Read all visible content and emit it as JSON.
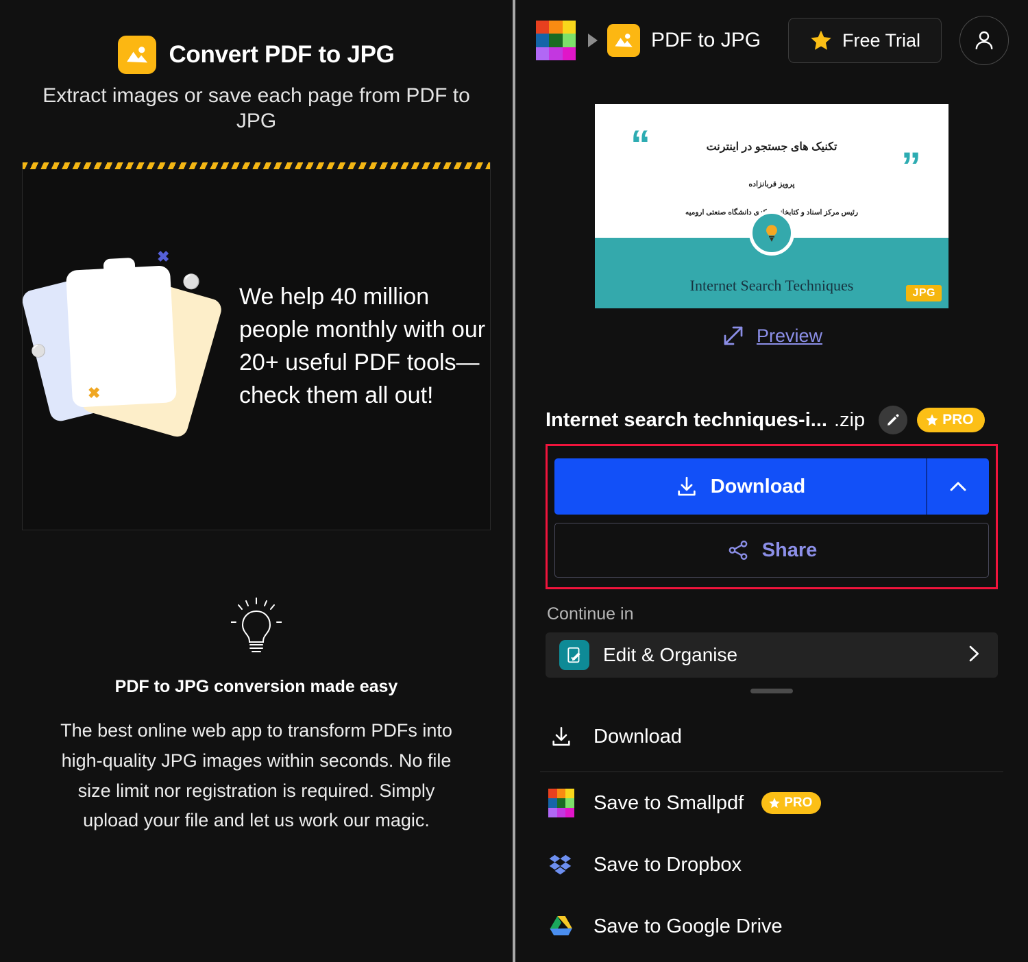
{
  "left_panel": {
    "tool_icon": "image-icon",
    "title": "Convert PDF to JPG",
    "subtitle": "Extract images or save each page from PDF to JPG",
    "promo": {
      "text": "We help 40 million people monthly with our 20+ useful PDF tools—check them all out!",
      "art": "stacked-paper-cards-illustration",
      "marks": [
        "x",
        "o",
        "o",
        "x"
      ]
    },
    "tip": {
      "icon": "lightbulb-icon",
      "title": "PDF to JPG conversion made easy",
      "body": "The best online web app to transform PDFs into high-quality JPG images within seconds. No file size limit nor registration is required. Simply upload your file and let us work our magic."
    }
  },
  "right_panel": {
    "topbar": {
      "logo": "smallpdf-logo",
      "breadcrumb_separator": "caret-right-icon",
      "tool_icon": "image-icon",
      "tool_name": "PDF to JPG",
      "free_trial_label": "Free Trial",
      "free_trial_icon": "star-icon",
      "account_icon": "user-avatar-icon"
    },
    "preview": {
      "slide_title_fa": "تکنیک های جستجو در اینترنت",
      "slide_author_fa": "پرویز قربانزاده",
      "slide_affiliation_fa": "رئیس مرکز اسناد و کتابخانه مرکزی دانشگاه صنعتی ارومیه",
      "slide_title_en": "Internet Search Techniques",
      "format_badge": "JPG",
      "quote_open": "“",
      "quote_close": "”",
      "bulb_icon": "lightbulb-icon",
      "preview_link": "Preview",
      "preview_icon": "expand-arrow-icon"
    },
    "file": {
      "name": "Internet search techniques-i...",
      "extension": ".zip",
      "edit_icon": "pencil-icon",
      "pro_badge": "PRO",
      "pro_icon": "star-icon"
    },
    "actions": {
      "download_label": "Download",
      "download_icon": "download-icon",
      "download_caret": "chevron-up-icon",
      "share_label": "Share",
      "share_icon": "share-nodes-icon",
      "highlight_color": "#f0143c",
      "download_color": "#1250f8"
    },
    "continue": {
      "section_label": "Continue in",
      "item_label": "Edit & Organise",
      "item_icon": "edit-document-icon",
      "chevron": "chevron-right-icon"
    },
    "menu": [
      {
        "label": "Download",
        "icon": "download-icon",
        "badge": null
      },
      {
        "label": "Save to Smallpdf",
        "icon": "smallpdf-logo-icon",
        "badge": "PRO"
      },
      {
        "label": "Save to Dropbox",
        "icon": "dropbox-icon",
        "badge": null
      },
      {
        "label": "Save to Google Drive",
        "icon": "google-drive-icon",
        "badge": null
      }
    ]
  }
}
